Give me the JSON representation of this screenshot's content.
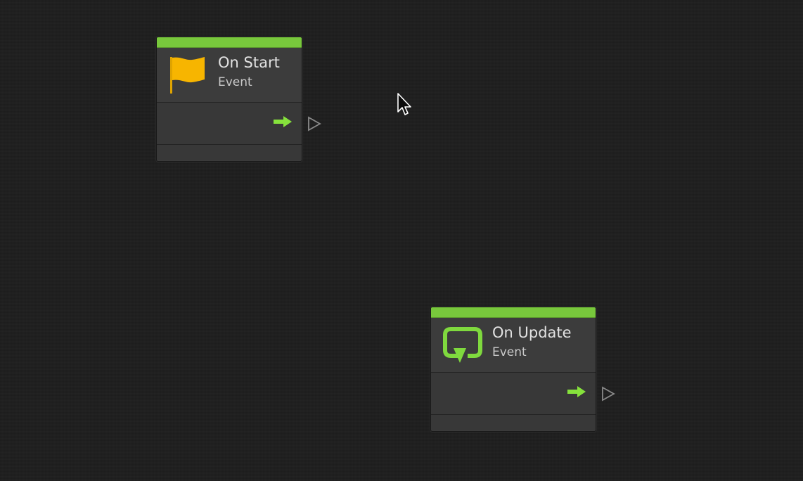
{
  "graph": {
    "nodes": [
      {
        "id": "on-start",
        "title": "On Start",
        "subtitle": "Event",
        "icon": "flag-icon",
        "header_color": "#78c83c",
        "icon_color": "#f7b500"
      },
      {
        "id": "on-update",
        "title": "On Update",
        "subtitle": "Event",
        "icon": "loop-arrow-icon",
        "header_color": "#78c83c",
        "icon_color": "#7fd93e"
      }
    ],
    "port_arrow_color": "#86e23c",
    "output_port_icon": "triangle-outline-icon",
    "cursor_icon": "mouse-pointer-icon"
  }
}
